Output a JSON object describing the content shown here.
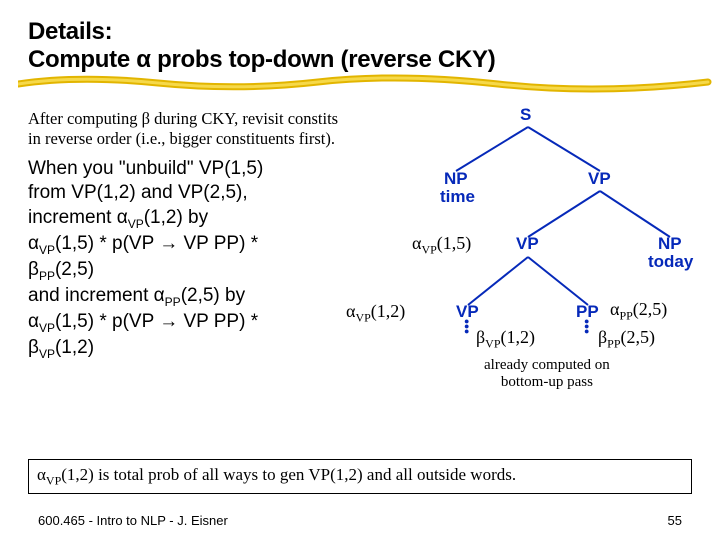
{
  "title_line1": "Details:",
  "title_line2": "Compute α probs top-down (reverse CKY)",
  "intro": "After computing β during CKY, revisit constits in reverse order (i.e., bigger constituents first).",
  "body_l1": "When you \"unbuild\" VP(1,5)",
  "body_l2": "from VP(1,2) and VP(2,5),",
  "body_l3a": "increment α",
  "body_l3b": "(1,2) by",
  "body_l4a": "α",
  "body_l4b": "(1,5) * p(VP → VP PP) *",
  "body_l5a": "β",
  "body_l5b": "(2,5)",
  "body_l6a": "and increment α",
  "body_l6b": "(2,5) by",
  "body_l7a": "α",
  "body_l7b": "(1,5) * p(VP → VP PP) *",
  "body_l8a": "β",
  "body_l8b": "(1,2)",
  "sub_vp": "VP",
  "sub_pp": "PP",
  "node_S": "S",
  "node_NP": "NP",
  "node_time": "time",
  "node_VP": "VP",
  "node_VP2": "VP",
  "node_NP2": "NP",
  "node_today": "today",
  "node_VP3": "VP",
  "node_PP": "PP",
  "a15": "(1,5)",
  "a12": "(1,2)",
  "a25": "(2,5)",
  "b12": "(1,2)",
  "b25": "(2,5)",
  "note1": "already computed on",
  "note2": "bottom-up pass",
  "bottom_a": "α",
  "bottom_b": "(1,2) is total prob of all ways to gen VP(1,2) and all outside words.",
  "footer_left": "600.465 - Intro to NLP - J. Eisner",
  "footer_right": "55"
}
